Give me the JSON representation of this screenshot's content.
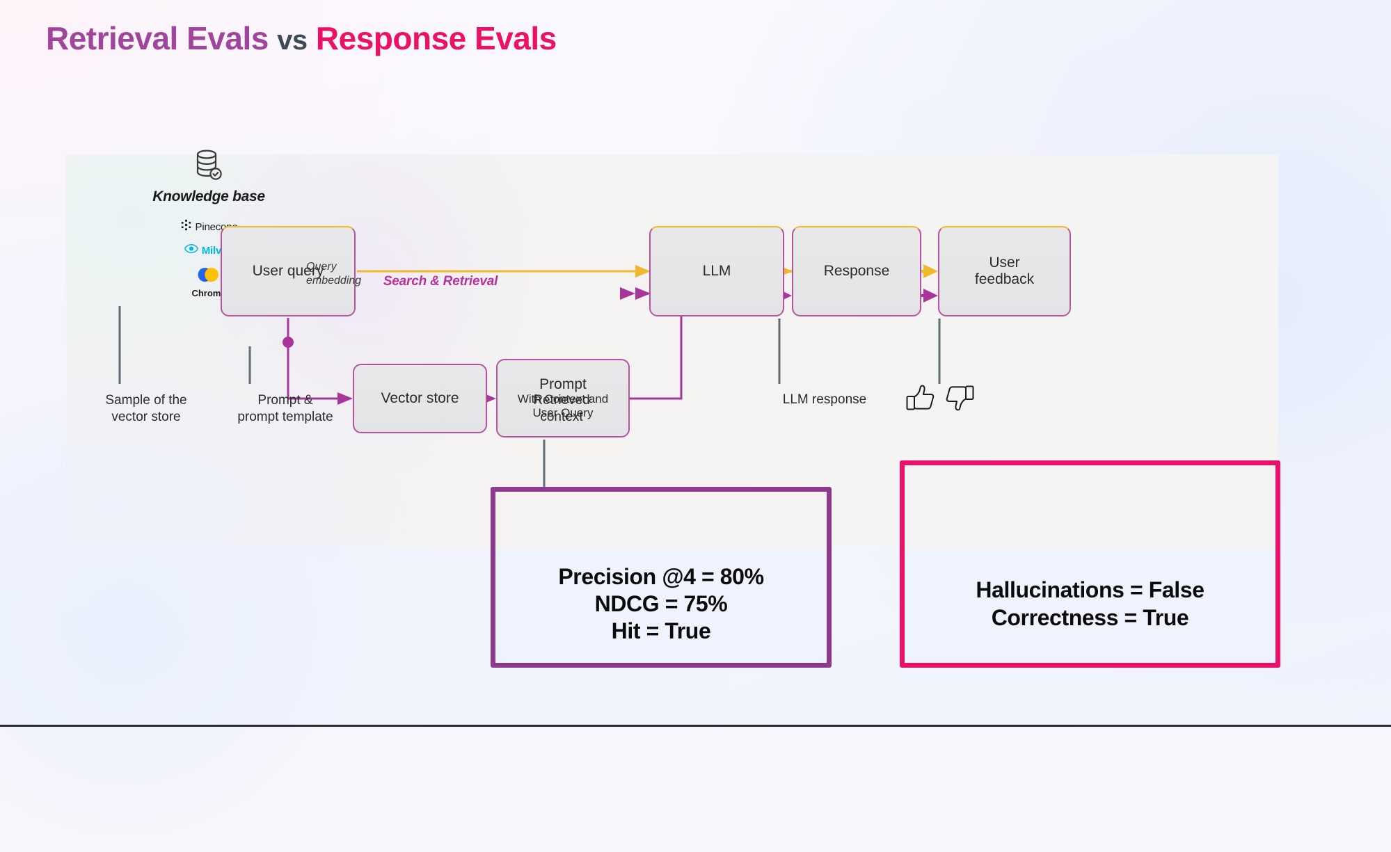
{
  "title": {
    "part1": "Retrieval Evals",
    "part2": "vs",
    "part3": "Response Evals",
    "color_purple": "#a0459b",
    "color_pink": "#ec1066",
    "color_vs": "#3d4a59"
  },
  "knowledge_base": {
    "icon": "database-check-icon",
    "heading": "Knowledge base",
    "vendors": [
      {
        "name": "Pinecone",
        "icon": "pinecone-logo-icon"
      },
      {
        "name": "Milvus",
        "icon": "milvus-logo-icon"
      },
      {
        "name": "Chroma",
        "icon": "chroma-logo-icon"
      }
    ]
  },
  "flow": {
    "user_query": {
      "label": "User query"
    },
    "vector_store": {
      "label": "Vector store"
    },
    "prompt": {
      "label": "Prompt",
      "sub_line1": "With Context and",
      "sub_line2": "User Query"
    },
    "llm": {
      "label": "LLM"
    },
    "response": {
      "label": "Response"
    },
    "user_feedback": {
      "line1": "User",
      "line2": "feedback"
    }
  },
  "annotations": {
    "query_embedding_line1": "Query",
    "query_embedding_line2": "embedding",
    "search_retrieval": "Search & Retrieval",
    "sample_vector_store_line1": "Sample of the",
    "sample_vector_store_line2": "vector store",
    "prompt_template_line1": "Prompt &",
    "prompt_template_line2": "prompt template",
    "retrieved_context_line1": "Retrieved",
    "retrieved_context_line2": "context",
    "llm_response": "LLM response",
    "thumb_up_icon": "thumbs-up-icon",
    "thumb_down_icon": "thumbs-down-icon"
  },
  "callouts": {
    "retrieval": {
      "border_color": "#8e3a8c",
      "metrics_line1": "Precision @4 = 80%",
      "metrics_line2": "NDCG = 75%",
      "metrics_line3": "Hit = True"
    },
    "response": {
      "border_color": "#ec1068",
      "metrics_line1": "Hallucinations = False",
      "metrics_line2": "Correctness = True"
    }
  },
  "colors": {
    "arrow_yellow": "#f0b92c",
    "arrow_magenta": "#a8359a",
    "connector_gray": "#5f6b77",
    "box_border_magenta": "#b5539f",
    "box_fill": "#e6e6e9"
  }
}
